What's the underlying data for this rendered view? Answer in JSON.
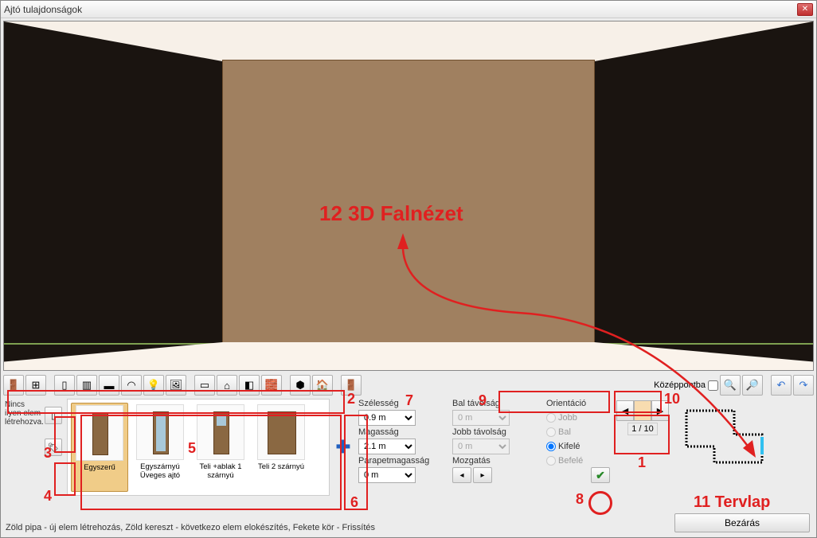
{
  "window": {
    "title": "Ajtó tulajdonságok"
  },
  "toolbar": {
    "center_label": "Középpontba",
    "center_checked": false
  },
  "left_message": "Nincs ilyen elem létrehozva.",
  "gallery": {
    "items": [
      {
        "label": "Egyszerű",
        "selected": true,
        "kind": "plain"
      },
      {
        "label": "Egyszárnyú Üveges ajtó",
        "selected": false,
        "kind": "glass"
      },
      {
        "label": "Teli +ablak 1 szárnyú",
        "selected": false,
        "kind": "window"
      },
      {
        "label": "Teli 2 szárnyú",
        "selected": false,
        "kind": "double"
      }
    ]
  },
  "props": {
    "width_label": "Szélesség",
    "width_value": "0.9 m",
    "height_label": "Magasság",
    "height_value": "2.1 m",
    "parapet_label": "Parapetmagasság",
    "parapet_value": "0 m",
    "left_dist_label": "Bal távolság",
    "left_dist_value": "0 m",
    "right_dist_label": "Jobb távolság",
    "right_dist_value": "0 m",
    "move_label": "Mozgatás",
    "orient_label": "Orientáció",
    "orient_right": "Jobb",
    "orient_left": "Bal",
    "orient_out": "Kifelé",
    "orient_in": "Befelé"
  },
  "nav": {
    "page": "1 / 10"
  },
  "status": "Zöld pipa - új elem létrehozás, Zöld kereszt - következo elem elokészítés, Fekete kör - Frissítés",
  "close_label": "Bezárás",
  "annotations": {
    "a12": "12 3D Falnézet",
    "a11": "11 Tervlap",
    "a1": "1",
    "a2": "2",
    "a3": "3",
    "a4": "4",
    "a5": "5",
    "a6": "6",
    "a7": "7",
    "a8": "8",
    "a9": "9",
    "a10": "10"
  }
}
